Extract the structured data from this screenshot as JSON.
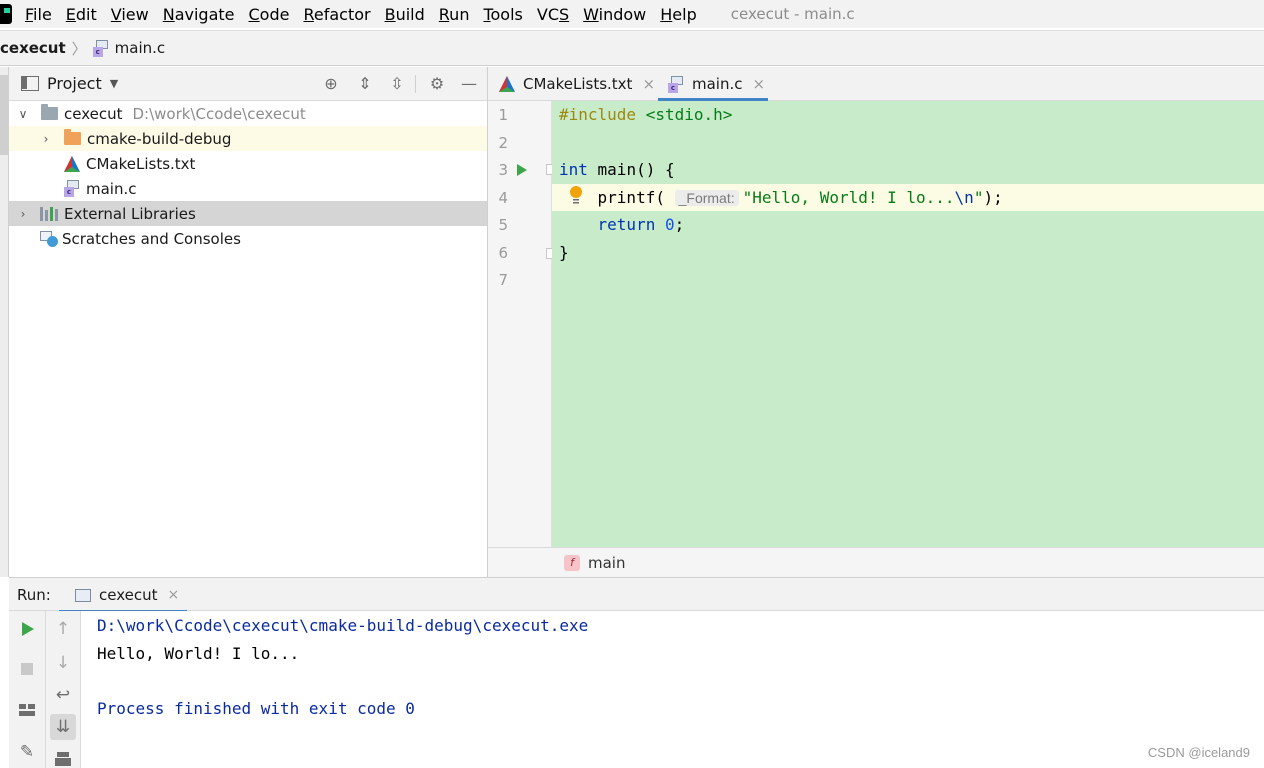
{
  "menu": {
    "items": [
      "File",
      "Edit",
      "View",
      "Navigate",
      "Code",
      "Refactor",
      "Build",
      "Run",
      "Tools",
      "VCS",
      "Window",
      "Help"
    ],
    "window_title": "cexecut - main.c"
  },
  "breadcrumb": {
    "project": "cexecut",
    "file": "main.c"
  },
  "project_panel": {
    "title": "Project",
    "tree": [
      {
        "label": "cexecut",
        "path": "D:\\work\\Ccode\\cexecut"
      },
      {
        "label": "cmake-build-debug"
      },
      {
        "label": "CMakeLists.txt"
      },
      {
        "label": "main.c"
      },
      {
        "label": "External Libraries"
      },
      {
        "label": "Scratches and Consoles"
      }
    ]
  },
  "editor": {
    "tabs": [
      {
        "label": "CMakeLists.txt",
        "close": "×"
      },
      {
        "label": "main.c",
        "close": "×"
      }
    ],
    "line_numbers": [
      "1",
      "2",
      "3",
      "4",
      "5",
      "6",
      "7"
    ],
    "code": {
      "l1_directive": "#include",
      "l1_header": " <stdio.h>",
      "l3_kw": "int",
      "l3_rest": " main() {",
      "l4_fn": "    printf(",
      "l4_hint": "_Format:",
      "l4_str": "\"Hello, World! I lo...",
      "l4_esc": "\\n",
      "l4_str_end": "\"",
      "l4_end": ");",
      "l5_kw": "    return",
      "l5_num": " 0",
      "l5_end": ";",
      "l6": "}"
    },
    "breadcrumb_fn_icon": "f",
    "breadcrumb_fn": "main"
  },
  "run": {
    "title": "Run:",
    "tab_label": "cexecut",
    "tab_close": "×",
    "console": {
      "line1": "D:\\work\\Ccode\\cexecut\\cmake-build-debug\\cexecut.exe",
      "line2": "Hello, World! I lo...",
      "line3": "Process finished with exit code 0"
    }
  },
  "watermark": "CSDN @iceland9",
  "colors": {
    "editor_bg": "#c8ecca",
    "current_line": "#fcfbe3",
    "accent": "#4083c9",
    "folder_orange": "#f0a25a",
    "folder_gray": "#9aa7b0"
  }
}
